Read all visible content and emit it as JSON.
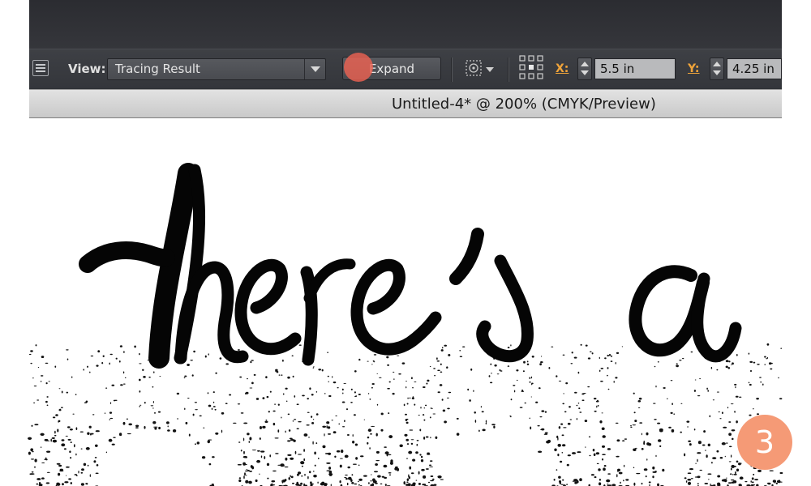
{
  "toolbar": {
    "view_label": "View:",
    "view_value": "Tracing Result",
    "expand_label": "Expand",
    "x_label": "X:",
    "x_value": "5.5 in",
    "y_label": "Y:",
    "y_value": "4.25 in",
    "icons": [
      "panel-menu-icon",
      "dropdown-arrow-icon",
      "transform-icon",
      "reference-point-icon",
      "stepper-icon"
    ]
  },
  "document": {
    "tab_title": "Untitled-4* @ 200% (CMYK/Preview)"
  },
  "artwork": {
    "lettering": "there's a"
  },
  "tutorial": {
    "step_number": "3"
  },
  "colors": {
    "toolbar_dark": "#3a3c41",
    "coord_label": "#f0a43a",
    "click_marker": "#eb6252",
    "step_badge": "#f59a76"
  }
}
